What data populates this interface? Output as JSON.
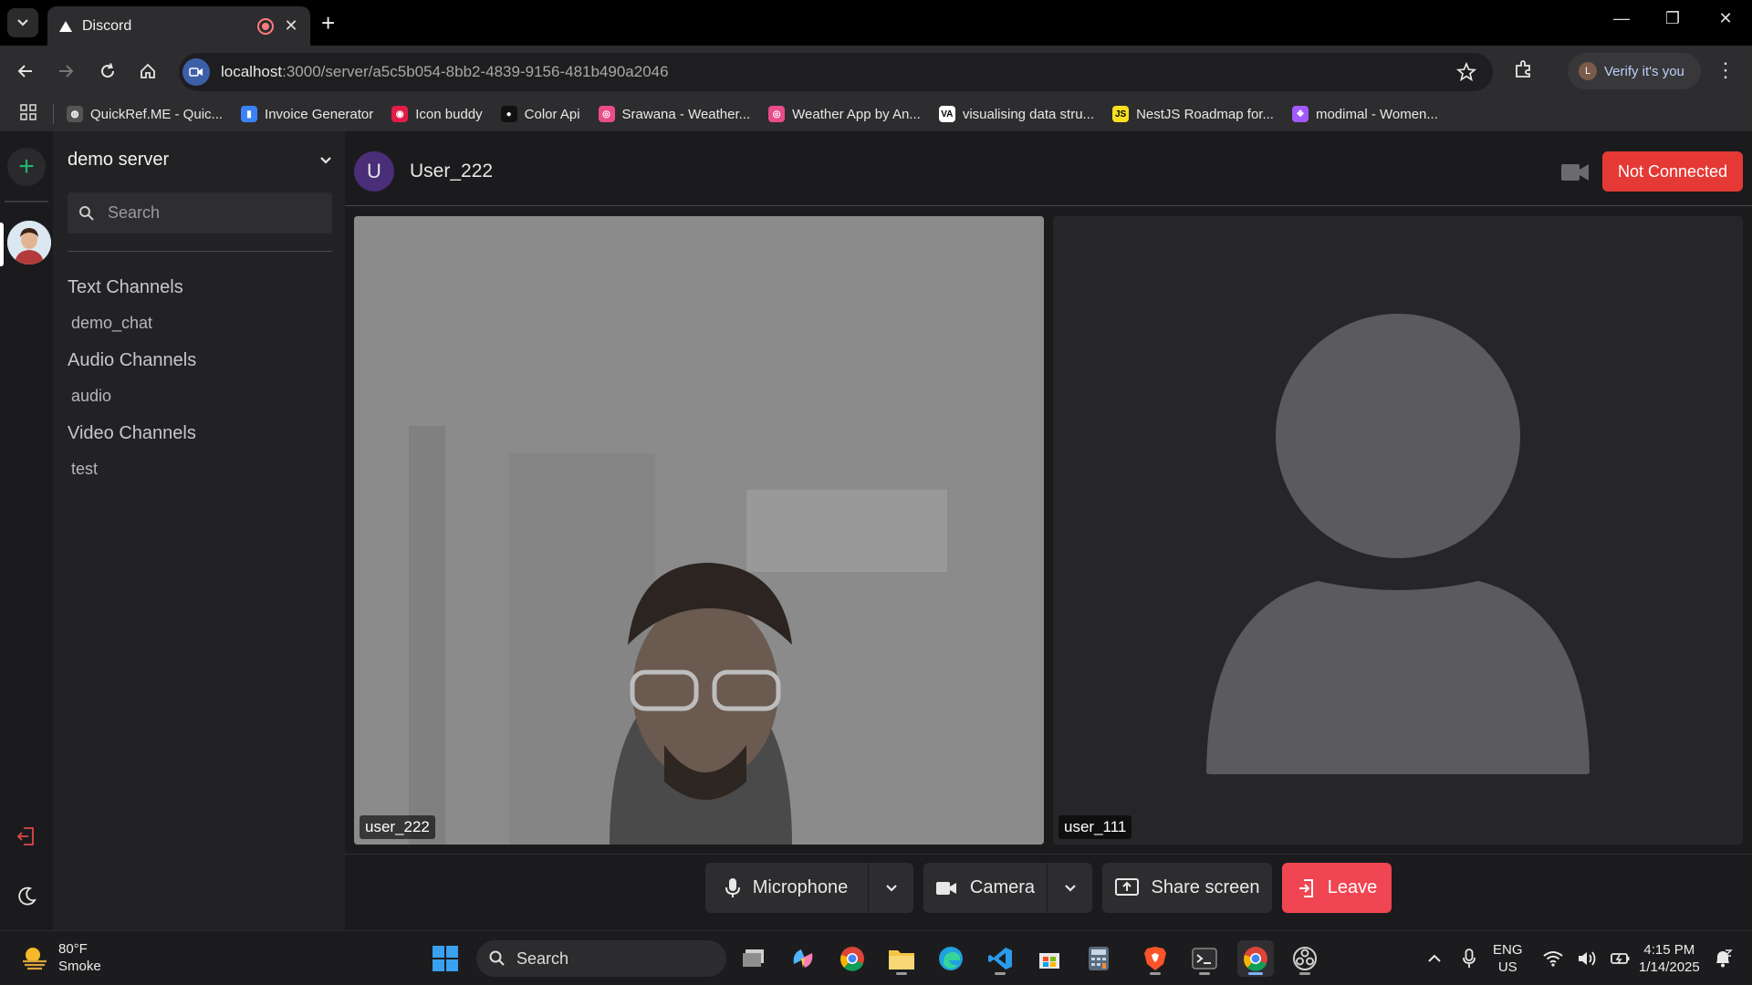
{
  "browser": {
    "tab": {
      "title": "Discord"
    },
    "url_host": "localhost",
    "url_path": ":3000/server/a5c5b054-8bb2-4839-9156-481b490a2046",
    "verify_label": "Verify it's you",
    "profile_initial": "L",
    "bookmarks": [
      {
        "label": "QuickRef.ME - Quic...",
        "icon": "globe-icon",
        "color": "#555555"
      },
      {
        "label": "Invoice Generator",
        "icon": "doc-icon",
        "color": "#3b82f6"
      },
      {
        "label": "Icon buddy",
        "icon": "icon-buddy-icon",
        "color": "#e11d48"
      },
      {
        "label": "Color Api",
        "icon": "github-icon",
        "color": "#111111"
      },
      {
        "label": "Srawana - Weather...",
        "icon": "dribbble-icon",
        "color": "#ea4c89"
      },
      {
        "label": "Weather App by An...",
        "icon": "dribbble-icon",
        "color": "#ea4c89"
      },
      {
        "label": "visualising data stru...",
        "icon": "visualgo-icon",
        "color": "#ffffff"
      },
      {
        "label": "NestJS Roadmap for...",
        "icon": "js-icon",
        "color": "#f7df1e"
      },
      {
        "label": "modimal - Women...",
        "icon": "figma-icon",
        "color": "#a259ff"
      }
    ]
  },
  "sidebar": {
    "server_name": "demo server",
    "search_placeholder": "Search",
    "categories": [
      {
        "label": "Text Channels",
        "channels": [
          "demo_chat"
        ]
      },
      {
        "label": "Audio Channels",
        "channels": [
          "audio"
        ]
      },
      {
        "label": "Video Channels",
        "channels": [
          "test"
        ]
      }
    ]
  },
  "call": {
    "avatar_initial": "U",
    "user_name": "User_222",
    "status_label": "Not Connected",
    "participants": [
      {
        "name": "user_222"
      },
      {
        "name": "user_111"
      }
    ],
    "controls": {
      "microphone": "Microphone",
      "camera": "Camera",
      "share": "Share screen",
      "leave": "Leave"
    }
  },
  "colors": {
    "accent_green": "#22b573",
    "danger_red": "#e53935",
    "leave_red": "#f04552",
    "avatar_purple": "#4a2e78"
  },
  "taskbar": {
    "weather_temp": "80°F",
    "weather_desc": "Smoke",
    "search_label": "Search",
    "lang_1": "ENG",
    "lang_2": "US",
    "time": "4:15 PM",
    "date": "1/14/2025"
  }
}
